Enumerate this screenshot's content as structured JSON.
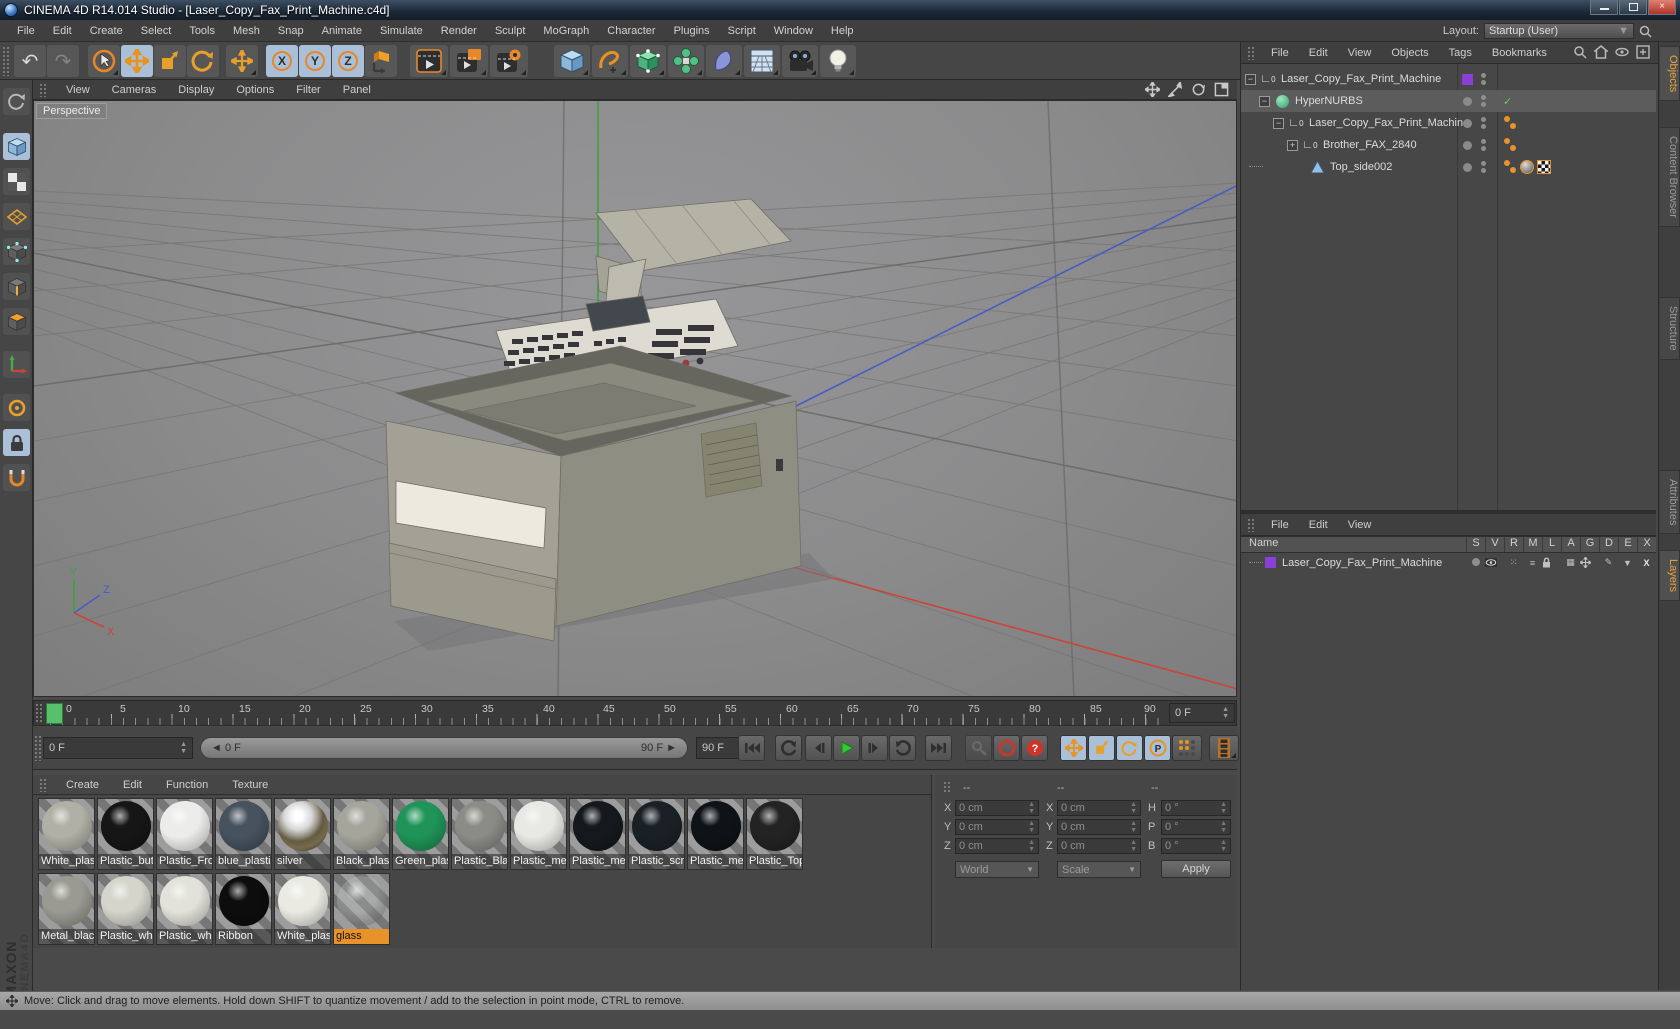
{
  "window": {
    "title": "CINEMA 4D R14.014 Studio - [Laser_Copy_Fax_Print_Machine.c4d]",
    "controls": [
      "minimize",
      "maximize",
      "close"
    ]
  },
  "menu_bar": {
    "items": [
      "File",
      "Edit",
      "Create",
      "Select",
      "Tools",
      "Mesh",
      "Snap",
      "Animate",
      "Simulate",
      "Render",
      "Sculpt",
      "MoGraph",
      "Character",
      "Plugins",
      "Script",
      "Window",
      "Help"
    ],
    "layout_label": "Layout:",
    "layout_value": "Startup (User)"
  },
  "toolbar": {
    "icons": [
      "undo",
      "redo",
      "live-selection",
      "move",
      "scale",
      "rotate",
      "last-tool",
      "lock-x-axis",
      "lock-y-axis",
      "lock-z-axis",
      "coordinate-system",
      "render-view",
      "render-to-picture-viewer",
      "edit-render-settings",
      "add-cube",
      "add-spline",
      "add-hypernurbs",
      "add-cloner",
      "add-deformer",
      "add-environment",
      "add-camera",
      "add-light"
    ],
    "axis_letters": [
      "X",
      "Y",
      "Z"
    ]
  },
  "left_toolbar": {
    "icons": [
      "make-editable",
      "model-mode",
      "texture-mode",
      "workplane-mode",
      "points-mode",
      "edges-mode",
      "polygons-mode",
      "axis-mode",
      "enable-axis",
      "lock-workplane",
      "snap-settings"
    ]
  },
  "viewport": {
    "menu_items": [
      "View",
      "Cameras",
      "Display",
      "Options",
      "Filter",
      "Panel"
    ],
    "camera_label": "Perspective",
    "nav_icons": [
      "pan-icon",
      "zoom-icon",
      "orbit-icon",
      "toggle-view-icon"
    ],
    "axis_labels": {
      "x": "X",
      "y": "Y",
      "z": "Z"
    }
  },
  "object_manager": {
    "menu_items": [
      "File",
      "Edit",
      "View",
      "Objects",
      "Tags",
      "Bookmarks"
    ],
    "corner_icons": [
      "search-icon",
      "home-icon",
      "eye-icon",
      "add-panel-icon"
    ],
    "tree": [
      {
        "name": "Laser_Copy_Fax_Print_Machine"
      },
      {
        "name": "HyperNURBS"
      },
      {
        "name": "Laser_Copy_Fax_Print_Machine"
      },
      {
        "name": "Brother_FAX_2840"
      },
      {
        "name": "Top_side002"
      }
    ],
    "layer_swatch_color": "#8b3fd9",
    "tabs": [
      "Objects",
      "Content Browser",
      "Structure"
    ]
  },
  "layer_manager": {
    "menu_items": [
      "File",
      "Edit",
      "View"
    ],
    "name_header": "Name",
    "columns": [
      "S",
      "V",
      "R",
      "M",
      "L",
      "A",
      "G",
      "D",
      "E",
      "X"
    ],
    "row_name": "Laser_Copy_Fax_Print_Machine",
    "tabs": [
      "Attributes",
      "Layers"
    ]
  },
  "timeline": {
    "tick_labels": [
      "0",
      "5",
      "10",
      "15",
      "20",
      "25",
      "30",
      "35",
      "40",
      "45",
      "50",
      "55",
      "60",
      "65",
      "70",
      "75",
      "80",
      "85",
      "90"
    ],
    "ruler_frame_field": "0 F",
    "current_frame_field": "0 F",
    "range_start_label": "0 F",
    "range_end_label": "90 F",
    "end_frame_field": "90 F",
    "transport_icons": [
      "goto-start",
      "play-backwards",
      "previous-frame",
      "play-forwards",
      "next-frame",
      "play-loop",
      "goto-end",
      "record-key",
      "autokey",
      "help",
      "key-position",
      "key-scale",
      "key-rotation",
      "key-parameter",
      "key-pla",
      "timeline-window"
    ]
  },
  "materials": {
    "menu_items": [
      "Create",
      "Edit",
      "Function",
      "Texture"
    ],
    "row1": [
      {
        "label": "White_plas",
        "color": "#b0b0a6"
      },
      {
        "label": "Plastic_but",
        "color": "#161616"
      },
      {
        "label": "Plastic_Fro",
        "color": "#ececea"
      },
      {
        "label": "blue_plasti",
        "color": "#46525e"
      },
      {
        "label": "silver",
        "color": "#d2d2d0"
      },
      {
        "label": "Black_plast",
        "color": "#a5a59c"
      },
      {
        "label": "Green_plas",
        "color": "#1f9358"
      },
      {
        "label": "Plastic_Bla",
        "color": "#8c8c86"
      },
      {
        "label": "Plastic_mer",
        "color": "#e8e8e4"
      },
      {
        "label": "Plastic_mer",
        "color": "#15191d"
      },
      {
        "label": "Plastic_scre",
        "color": "#1a2126"
      },
      {
        "label": "Plastic_mer",
        "color": "#0f1317"
      },
      {
        "label": "Plastic_Top",
        "color": "#232323"
      }
    ],
    "row2": [
      {
        "label": "Metal_blac",
        "color": "#9a9a92"
      },
      {
        "label": "Plastic_whi",
        "color": "#d5d5cc"
      },
      {
        "label": "Plastic_whi",
        "color": "#e2e2da"
      },
      {
        "label": "Ribbon",
        "color": "#0d0d0d"
      },
      {
        "label": "White_plas",
        "color": "#eaeae2"
      },
      {
        "label": "glass",
        "color": "rgba(215,220,220,0.22)"
      }
    ],
    "selected_label": "glass",
    "selected_color": "#e8922c"
  },
  "coordinates": {
    "group_headers": [
      "--",
      "--",
      "--"
    ],
    "pos_labels": [
      "X",
      "Y",
      "Z"
    ],
    "pos_values": [
      "0 cm",
      "0 cm",
      "0 cm"
    ],
    "size_labels": [
      "X",
      "Y",
      "Z"
    ],
    "size_values": [
      "0 cm",
      "0 cm",
      "0 cm"
    ],
    "rot_labels": [
      "H",
      "P",
      "B"
    ],
    "rot_values": [
      "0 °",
      "0 °",
      "0 °"
    ],
    "space_dropdown": "World",
    "mode_dropdown": "Scale",
    "apply_button": "Apply"
  },
  "status_bar": {
    "text": "Move: Click and drag to move elements. Hold down SHIFT to quantize movement / add to the selection in point mode, CTRL to remove."
  },
  "branding": {
    "line1": "MAXON",
    "line2": "CINEMA4D"
  },
  "accent_colors": {
    "orange": "#e8922c",
    "selection_blue": "#a9c0d8",
    "axis_x": "#cc4438",
    "axis_y": "#3aa53a",
    "axis_z": "#4a5ac8",
    "play_green": "#37c837"
  }
}
